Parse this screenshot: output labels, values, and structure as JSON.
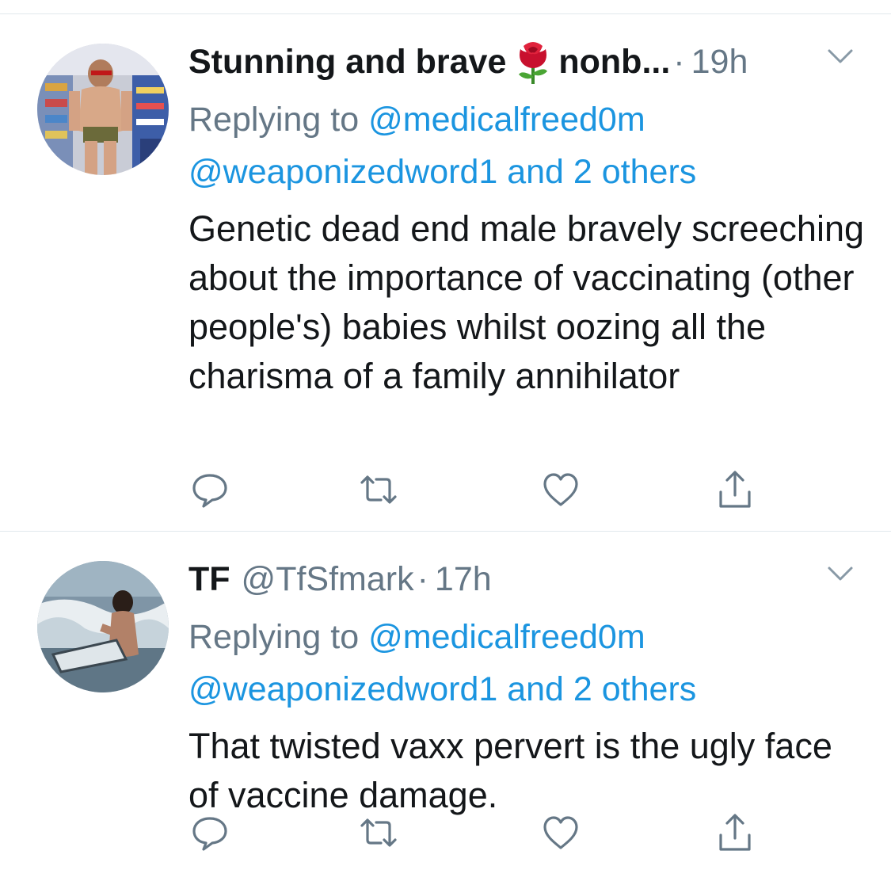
{
  "tweets": [
    {
      "display_name": "Stunning and brave",
      "emoji": "rose-emoji",
      "display_name_suffix": "nonb...",
      "handle": "",
      "separator": "·",
      "time": "19h",
      "replying_prefix": "Replying to",
      "replying_to": "@medicalfreed0m",
      "replying_others": "@weaponizedword1 and 2 others",
      "text": "Genetic dead end male bravely screeching about the importance of vaccinating (other people's) babies whilst oozing all the charisma of a family annihilator"
    },
    {
      "display_name": "TF",
      "handle": "@TfSfmark",
      "separator": "·",
      "time": "17h",
      "replying_prefix": "Replying to",
      "replying_to": "@medicalfreed0m",
      "replying_others": "@weaponizedword1 and 2 others",
      "text": "That twisted vaxx pervert is the ugly face of vaccine damage."
    }
  ],
  "icons": {
    "reply": "reply-icon",
    "retweet": "retweet-icon",
    "like": "like-icon",
    "share": "share-icon",
    "menu": "chevron-down-icon"
  },
  "colors": {
    "text": "#14171a",
    "secondary": "#657786",
    "link": "#1b95e0",
    "divider": "#e1e8ed"
  }
}
